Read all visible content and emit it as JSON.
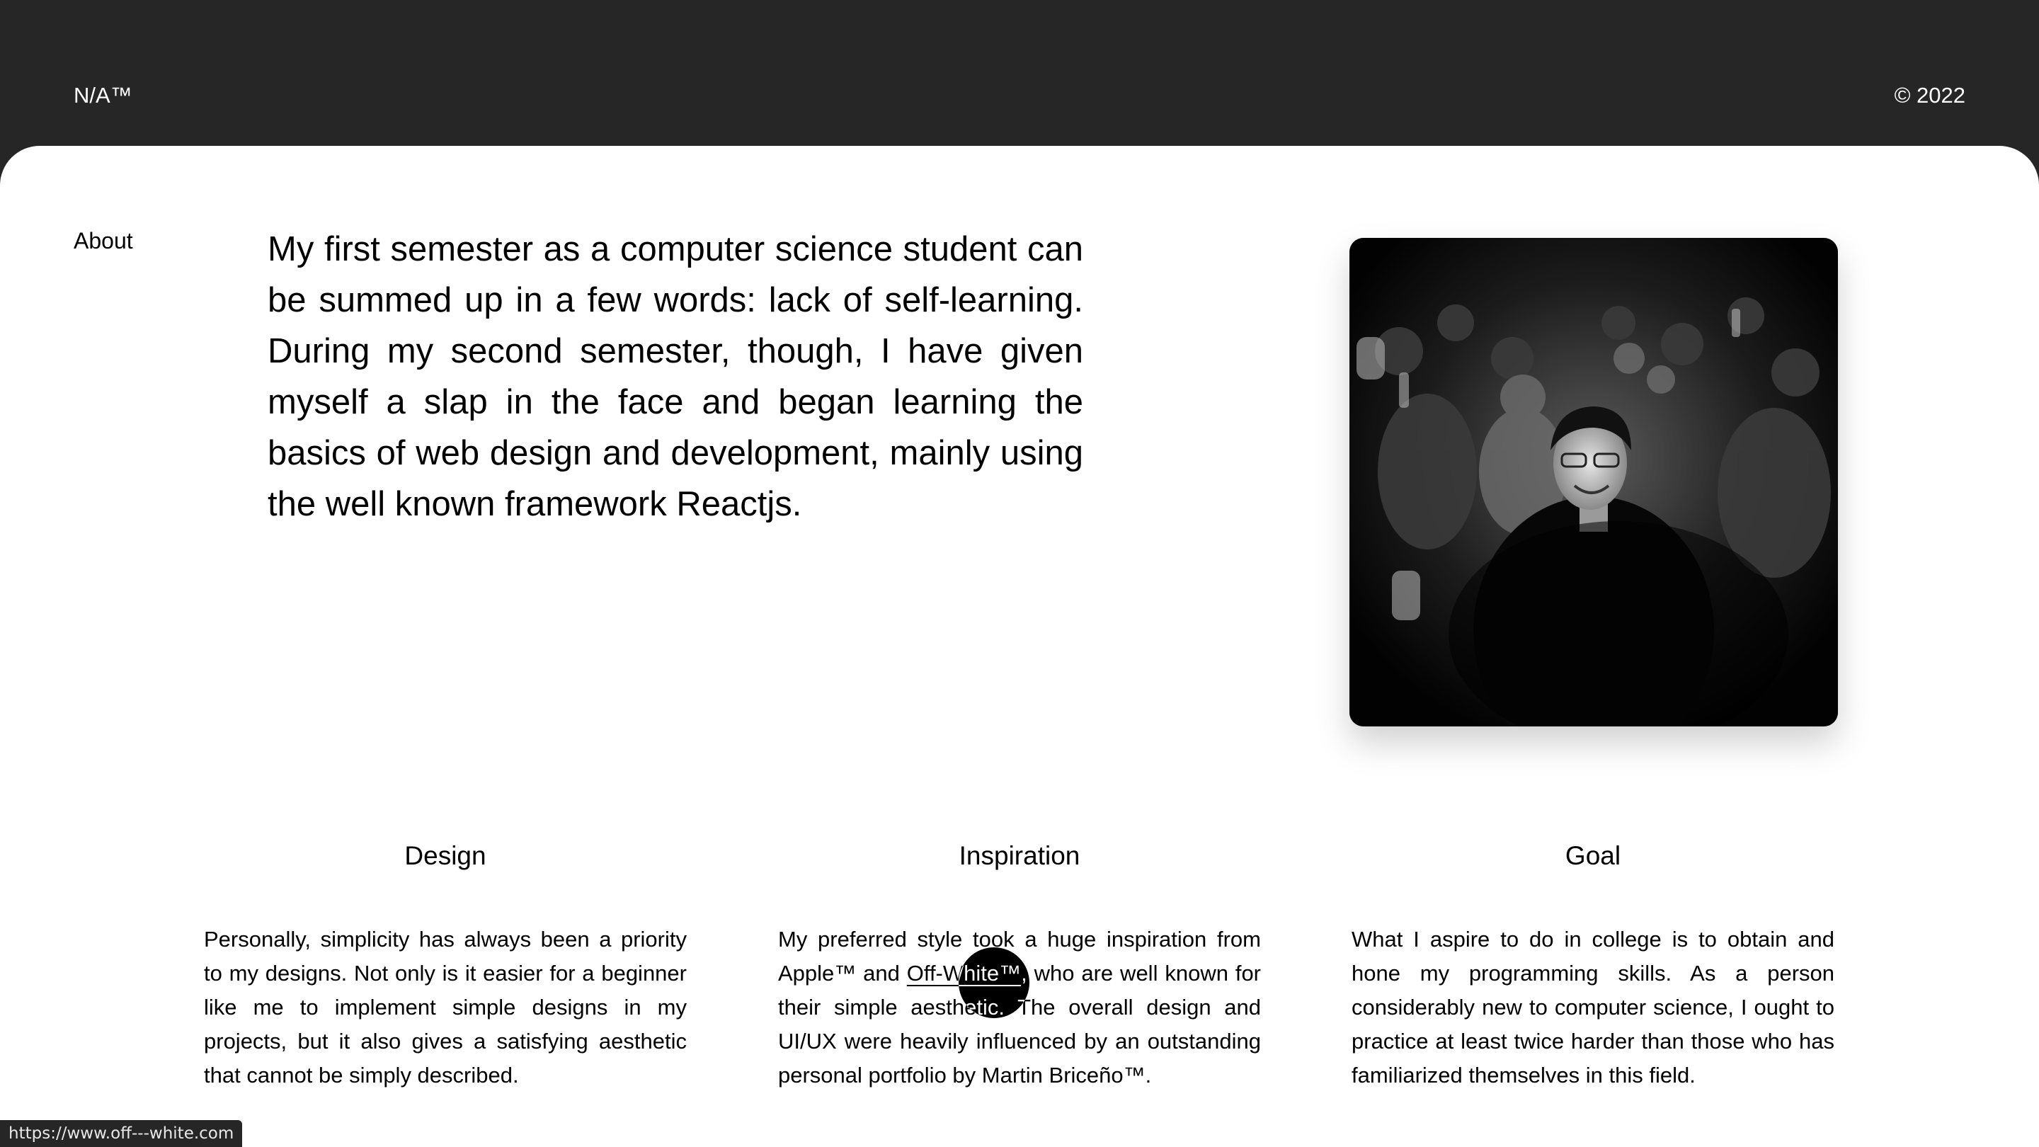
{
  "header": {
    "brand": "N/A™",
    "copyright": "© 2022"
  },
  "about": {
    "label": "About",
    "intro": "My first semester as a computer science student can be summed up in a few words: lack of self-learning. During my second semester, though, I have given myself a slap in the face and began learning the basics of web design and development, mainly using the well known framework Reactjs.",
    "photo_icon": "portrait-photo"
  },
  "columns": {
    "design": {
      "title": "Design",
      "body": "Personally, simplicity has always been a priority to my designs. Not only is it easier for a beginner like me to implement simple designs in my projects, but it also gives a satisfying aesthetic that cannot be simply described."
    },
    "inspiration": {
      "title": "Inspiration",
      "body_before": "My preferred style took a huge inspiration from Apple™ and ",
      "link_text": "Off-White™",
      "body_after": ", who are well known for their simple aesthetic. The overall design and UI/UX were heavily influenced by an outstanding personal portfolio by Martin Briceño™."
    },
    "goal": {
      "title": "Goal",
      "body": "What I aspire to do in college is to obtain and hone my programming skills. As a person considerably new to computer science, I ought to practice at least twice harder than those who has familiarized themselves in this field."
    }
  },
  "status": {
    "url": "https://www.off---white.com"
  }
}
